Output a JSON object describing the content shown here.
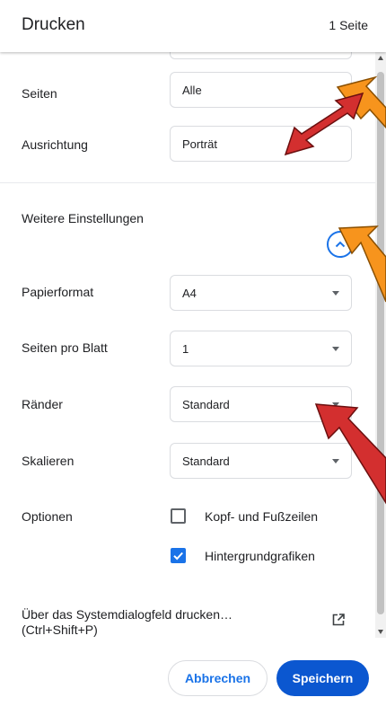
{
  "header": {
    "title": "Drucken",
    "page_count": "1 Seite"
  },
  "settings": {
    "pages": {
      "label": "Seiten",
      "value": "Alle"
    },
    "orientation": {
      "label": "Ausrichtung",
      "value": "Porträt"
    },
    "more_settings": {
      "label": "Weitere Einstellungen"
    },
    "paper_size": {
      "label": "Papierformat",
      "value": "A4"
    },
    "pages_per_sheet": {
      "label": "Seiten pro Blatt",
      "value": "1"
    },
    "margins": {
      "label": "Ränder",
      "value": "Standard"
    },
    "scale": {
      "label": "Skalieren",
      "value": "Standard"
    },
    "options": {
      "label": "Optionen",
      "items": [
        {
          "label": "Kopf- und Fußzeilen",
          "checked": false
        },
        {
          "label": "Hintergrundgrafiken",
          "checked": true
        }
      ]
    },
    "system_dialog": {
      "line1": "Über das Systemdialogfeld drucken…",
      "line2": "(Ctrl+Shift+P)"
    }
  },
  "footer": {
    "cancel_label": "Abbrechen",
    "save_label": "Speichern"
  },
  "icons": {
    "expand": "chevron-up-icon",
    "external": "open-in-new-icon",
    "check": "check-icon"
  },
  "colors": {
    "accent": "#1a73e8",
    "primary_button": "#0b57d0",
    "annotation_red": "#d32f2f",
    "annotation_orange": "#f7941d"
  }
}
